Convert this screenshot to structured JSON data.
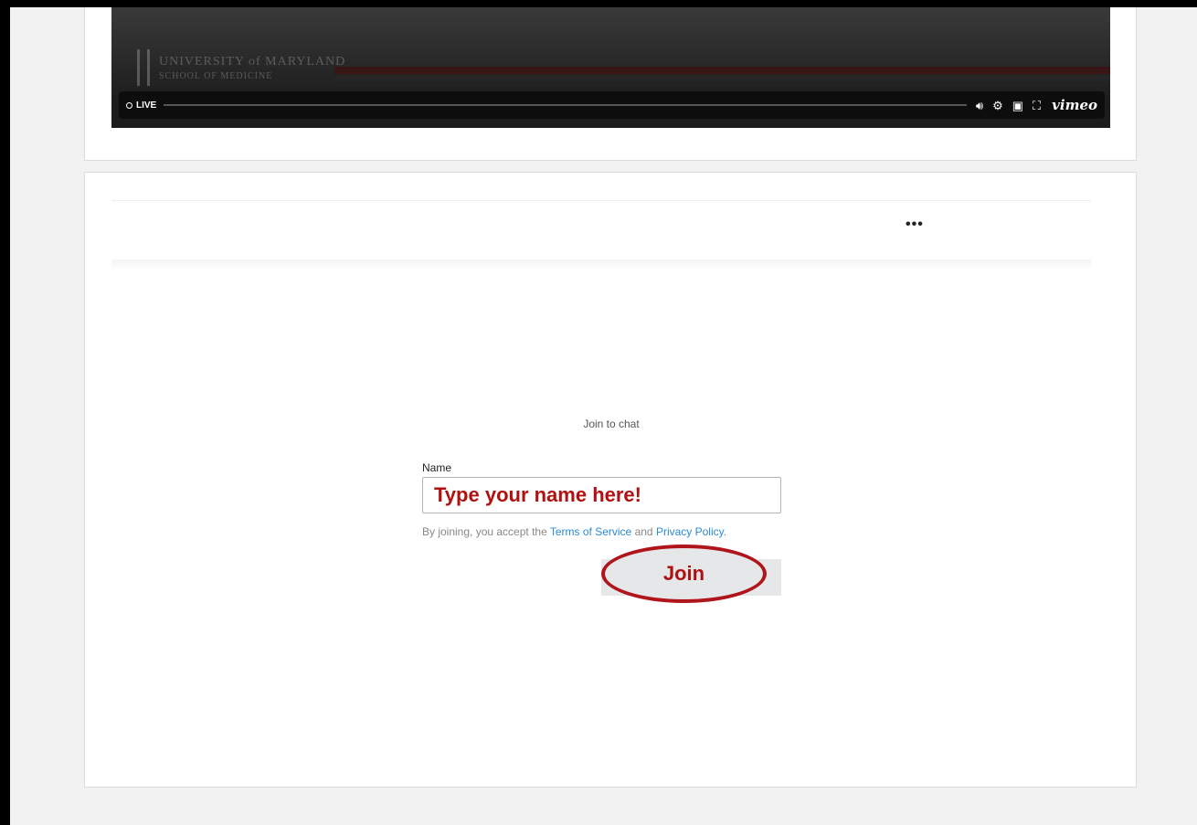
{
  "video": {
    "logo_line1": "UNIVERSITY of MARYLAND",
    "logo_line2": "SCHOOL OF MEDICINE",
    "live_label": "LIVE",
    "brand": "vimeo"
  },
  "chat": {
    "more_label": "•••",
    "title": "Join to chat",
    "name_label": "Name",
    "name_placeholder": "Type your name here!",
    "terms_prefix": "By joining, you accept the ",
    "terms_link": "Terms of Service",
    "terms_and": " and ",
    "privacy_link": "Privacy Policy",
    "terms_suffix": ".",
    "join_label": "Join"
  },
  "colors": {
    "accent_red": "#b0151b",
    "link_blue": "#2a8bd8"
  },
  "icons": [
    "volume-icon",
    "settings-icon",
    "pip-icon",
    "fullscreen-icon"
  ]
}
